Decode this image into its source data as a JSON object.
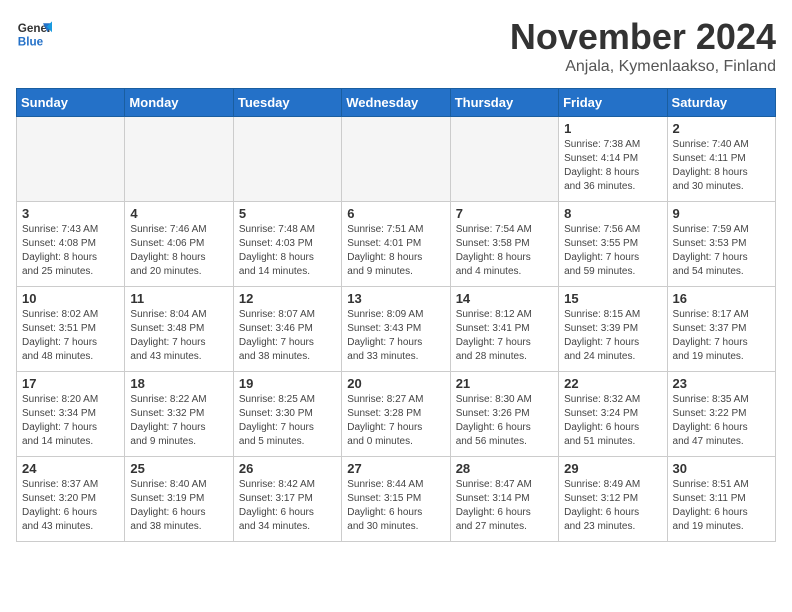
{
  "header": {
    "logo_line1": "General",
    "logo_line2": "Blue",
    "month": "November 2024",
    "location": "Anjala, Kymenlaakso, Finland"
  },
  "weekdays": [
    "Sunday",
    "Monday",
    "Tuesday",
    "Wednesday",
    "Thursday",
    "Friday",
    "Saturday"
  ],
  "weeks": [
    [
      {
        "day": "",
        "info": ""
      },
      {
        "day": "",
        "info": ""
      },
      {
        "day": "",
        "info": ""
      },
      {
        "day": "",
        "info": ""
      },
      {
        "day": "",
        "info": ""
      },
      {
        "day": "1",
        "info": "Sunrise: 7:38 AM\nSunset: 4:14 PM\nDaylight: 8 hours\nand 36 minutes."
      },
      {
        "day": "2",
        "info": "Sunrise: 7:40 AM\nSunset: 4:11 PM\nDaylight: 8 hours\nand 30 minutes."
      }
    ],
    [
      {
        "day": "3",
        "info": "Sunrise: 7:43 AM\nSunset: 4:08 PM\nDaylight: 8 hours\nand 25 minutes."
      },
      {
        "day": "4",
        "info": "Sunrise: 7:46 AM\nSunset: 4:06 PM\nDaylight: 8 hours\nand 20 minutes."
      },
      {
        "day": "5",
        "info": "Sunrise: 7:48 AM\nSunset: 4:03 PM\nDaylight: 8 hours\nand 14 minutes."
      },
      {
        "day": "6",
        "info": "Sunrise: 7:51 AM\nSunset: 4:01 PM\nDaylight: 8 hours\nand 9 minutes."
      },
      {
        "day": "7",
        "info": "Sunrise: 7:54 AM\nSunset: 3:58 PM\nDaylight: 8 hours\nand 4 minutes."
      },
      {
        "day": "8",
        "info": "Sunrise: 7:56 AM\nSunset: 3:55 PM\nDaylight: 7 hours\nand 59 minutes."
      },
      {
        "day": "9",
        "info": "Sunrise: 7:59 AM\nSunset: 3:53 PM\nDaylight: 7 hours\nand 54 minutes."
      }
    ],
    [
      {
        "day": "10",
        "info": "Sunrise: 8:02 AM\nSunset: 3:51 PM\nDaylight: 7 hours\nand 48 minutes."
      },
      {
        "day": "11",
        "info": "Sunrise: 8:04 AM\nSunset: 3:48 PM\nDaylight: 7 hours\nand 43 minutes."
      },
      {
        "day": "12",
        "info": "Sunrise: 8:07 AM\nSunset: 3:46 PM\nDaylight: 7 hours\nand 38 minutes."
      },
      {
        "day": "13",
        "info": "Sunrise: 8:09 AM\nSunset: 3:43 PM\nDaylight: 7 hours\nand 33 minutes."
      },
      {
        "day": "14",
        "info": "Sunrise: 8:12 AM\nSunset: 3:41 PM\nDaylight: 7 hours\nand 28 minutes."
      },
      {
        "day": "15",
        "info": "Sunrise: 8:15 AM\nSunset: 3:39 PM\nDaylight: 7 hours\nand 24 minutes."
      },
      {
        "day": "16",
        "info": "Sunrise: 8:17 AM\nSunset: 3:37 PM\nDaylight: 7 hours\nand 19 minutes."
      }
    ],
    [
      {
        "day": "17",
        "info": "Sunrise: 8:20 AM\nSunset: 3:34 PM\nDaylight: 7 hours\nand 14 minutes."
      },
      {
        "day": "18",
        "info": "Sunrise: 8:22 AM\nSunset: 3:32 PM\nDaylight: 7 hours\nand 9 minutes."
      },
      {
        "day": "19",
        "info": "Sunrise: 8:25 AM\nSunset: 3:30 PM\nDaylight: 7 hours\nand 5 minutes."
      },
      {
        "day": "20",
        "info": "Sunrise: 8:27 AM\nSunset: 3:28 PM\nDaylight: 7 hours\nand 0 minutes."
      },
      {
        "day": "21",
        "info": "Sunrise: 8:30 AM\nSunset: 3:26 PM\nDaylight: 6 hours\nand 56 minutes."
      },
      {
        "day": "22",
        "info": "Sunrise: 8:32 AM\nSunset: 3:24 PM\nDaylight: 6 hours\nand 51 minutes."
      },
      {
        "day": "23",
        "info": "Sunrise: 8:35 AM\nSunset: 3:22 PM\nDaylight: 6 hours\nand 47 minutes."
      }
    ],
    [
      {
        "day": "24",
        "info": "Sunrise: 8:37 AM\nSunset: 3:20 PM\nDaylight: 6 hours\nand 43 minutes."
      },
      {
        "day": "25",
        "info": "Sunrise: 8:40 AM\nSunset: 3:19 PM\nDaylight: 6 hours\nand 38 minutes."
      },
      {
        "day": "26",
        "info": "Sunrise: 8:42 AM\nSunset: 3:17 PM\nDaylight: 6 hours\nand 34 minutes."
      },
      {
        "day": "27",
        "info": "Sunrise: 8:44 AM\nSunset: 3:15 PM\nDaylight: 6 hours\nand 30 minutes."
      },
      {
        "day": "28",
        "info": "Sunrise: 8:47 AM\nSunset: 3:14 PM\nDaylight: 6 hours\nand 27 minutes."
      },
      {
        "day": "29",
        "info": "Sunrise: 8:49 AM\nSunset: 3:12 PM\nDaylight: 6 hours\nand 23 minutes."
      },
      {
        "day": "30",
        "info": "Sunrise: 8:51 AM\nSunset: 3:11 PM\nDaylight: 6 hours\nand 19 minutes."
      }
    ]
  ]
}
